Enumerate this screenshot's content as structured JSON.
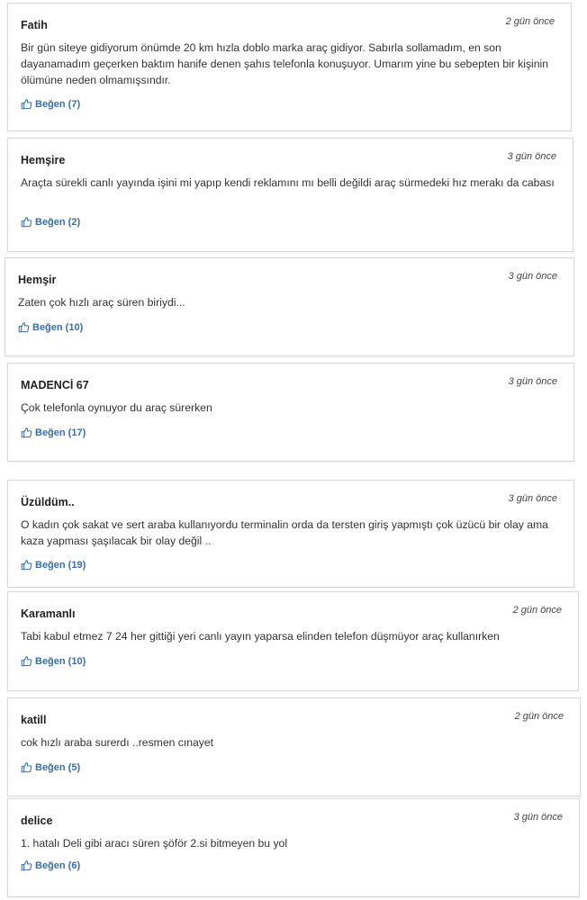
{
  "comments": [
    {
      "author": "Fatih",
      "time": "2 gün önce",
      "text": "Bir gün siteye gidiyorum önümde 20 km hızla doblo marka araç gidiyor. Sabırla sollamadım, en son dayanamadım geçerken baktım hanife denen şahıs telefonla konuşuyor. Umarım yine bu sebepten bir kişinin ölümüne neden olmamışsındır.",
      "like": "Beğen (7)"
    },
    {
      "author": "Hemşire",
      "time": "3 gün önce",
      "text": "Araçta sürekli canlı yayında işini mi yapıp kendi reklamını mı belli değildi araç sürmedeki hız merakı da cabası",
      "like": "Beğen (2)"
    },
    {
      "author": "Hemşir",
      "time": "3 gün önce",
      "text": "Zaten çok hızlı araç süren biriydi...",
      "like": "Beğen (10)"
    },
    {
      "author": "MADENCİ 67",
      "time": "3 gün önce",
      "text": "Çok telefonla oynuyor du araç sürerken",
      "like": "Beğen (17)"
    },
    {
      "author": "Üzüldüm..",
      "time": "3 gün önce",
      "text": "O kadın çok sakat ve sert araba kullanıyordu terminalin orda da tersten giriş yapmıştı çok üzücü bir olay ama kaza yapması şaşılacak bir olay değil ..",
      "like": "Beğen (19)"
    },
    {
      "author": "Karamanlı",
      "time": "2 gün önce",
      "text": "Tabi kabul etmez 7 24 her gittiği yeri canlı yayın yaparsa elinden telefon düşmüyor araç kullanırken",
      "like": "Beğen (10)"
    },
    {
      "author": "katill",
      "time": "2 gün önce",
      "text": "cok hızlı araba surerdı ..resmen cınayet",
      "like": "Beğen (5)"
    },
    {
      "author": "delice",
      "time": "3 gün önce",
      "text": "1. hatalı Deli gibi aracı süren şöför 2.si bitmeyen bu yol",
      "like": "Beğen (6)"
    }
  ]
}
